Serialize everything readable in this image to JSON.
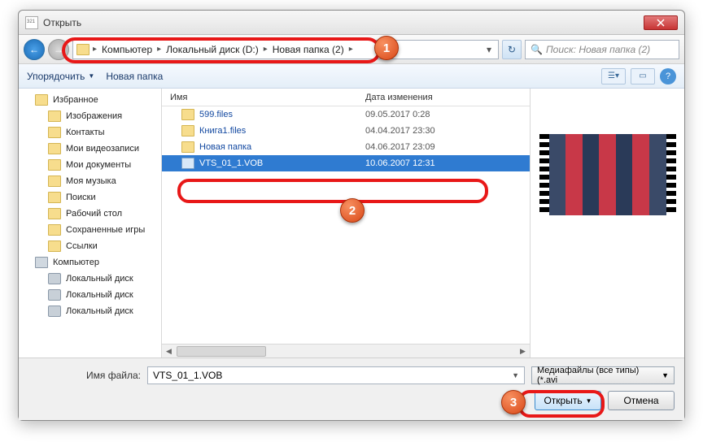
{
  "window": {
    "title": "Открыть"
  },
  "breadcrumb": {
    "segments": [
      "Компьютер",
      "Локальный диск (D:)",
      "Новая папка (2)"
    ]
  },
  "search": {
    "placeholder": "Поиск: Новая папка (2)"
  },
  "toolbar": {
    "organize": "Упорядочить",
    "newfolder": "Новая папка"
  },
  "tree": {
    "items": [
      {
        "label": "Избранное",
        "lvl": 1,
        "icon": "star"
      },
      {
        "label": "Изображения",
        "lvl": 2,
        "icon": "fold"
      },
      {
        "label": "Контакты",
        "lvl": 2,
        "icon": "fold"
      },
      {
        "label": "Мои видеозаписи",
        "lvl": 2,
        "icon": "fold"
      },
      {
        "label": "Мои документы",
        "lvl": 2,
        "icon": "fold"
      },
      {
        "label": "Моя музыка",
        "lvl": 2,
        "icon": "fold"
      },
      {
        "label": "Поиски",
        "lvl": 2,
        "icon": "fold"
      },
      {
        "label": "Рабочий стол",
        "lvl": 2,
        "icon": "fold"
      },
      {
        "label": "Сохраненные игры",
        "lvl": 2,
        "icon": "fold"
      },
      {
        "label": "Ссылки",
        "lvl": 2,
        "icon": "fold"
      },
      {
        "label": "Компьютер",
        "lvl": 1,
        "icon": "comp"
      },
      {
        "label": "Локальный диск",
        "lvl": 2,
        "icon": "disk"
      },
      {
        "label": "Локальный диск",
        "lvl": 2,
        "icon": "disk"
      },
      {
        "label": "Локальный диск",
        "lvl": 2,
        "icon": "disk"
      }
    ]
  },
  "columns": {
    "name": "Имя",
    "date": "Дата изменения"
  },
  "files": [
    {
      "name": "599.files",
      "date": "09.05.2017 0:28",
      "type": "folder",
      "selected": false
    },
    {
      "name": "Книга1.files",
      "date": "04.04.2017 23:30",
      "type": "folder",
      "selected": false
    },
    {
      "name": "Новая папка",
      "date": "04.06.2017 23:09",
      "type": "folder",
      "selected": false
    },
    {
      "name": "VTS_01_1.VOB",
      "date": "10.06.2007 12:31",
      "type": "video",
      "selected": true
    }
  ],
  "filename": {
    "label": "Имя файла:",
    "value": "VTS_01_1.VOB"
  },
  "filetype": {
    "label": "Медиафайлы (все типы) (*.avi"
  },
  "buttons": {
    "open": "Открыть",
    "cancel": "Отмена"
  },
  "callouts": {
    "c1": "1",
    "c2": "2",
    "c3": "3"
  }
}
